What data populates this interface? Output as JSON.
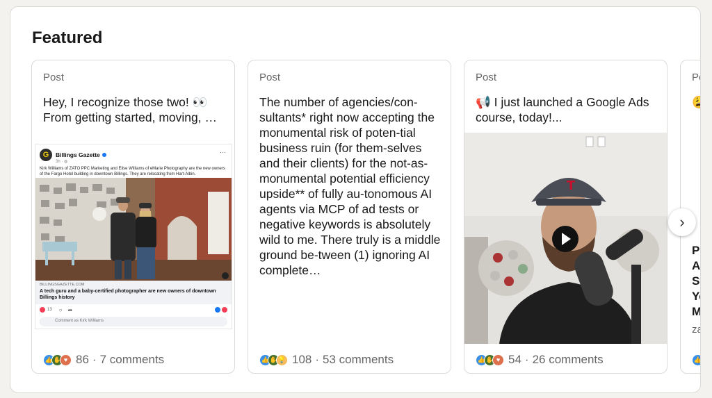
{
  "section": {
    "title": "Featured"
  },
  "cards": [
    {
      "type": "Post",
      "text": "Hey, I recognize those two! 👀 From getting started, moving, …",
      "reactions_count": "86",
      "comments": "7 comments",
      "embed": {
        "publisher": "Billings Gazette",
        "time": "3h · ◍",
        "caption": "Kirk Williams of ZATO PPC Marketing and Elise Williams of eMarie Photography are the new owners of the Fargo Hotel building in downtown Billings. They are relocating from Hart-Albin.",
        "domain": "BILLINGSGAZETTE.COM",
        "link_title": "A tech guru and a baby-certified photographer are new owners of downtown Billings history",
        "reaction_count": "13",
        "comment_placeholder": "Comment as Kirk Williams"
      }
    },
    {
      "type": "Post",
      "text": "The number of agencies/con-sultants* right now accepting the monumental risk of poten-tial business ruin (for them-selves and their clients) for the not-as-monumental potential efficiency upside** of fully au-tonomous AI agents via MCP of ad tests or negative keywords is absolutely wild to me. There truly is a middle ground be-tween (1) ignoring AI complete…",
      "reactions_count": "108",
      "comments": "53 comments"
    },
    {
      "type": "Post",
      "text": "📢 I just launched a Google Ads course, today!...",
      "reactions_count": "54",
      "comments": "26 comments"
    },
    {
      "type": "Po",
      "text": "😩 Pl",
      "lines": [
        "Pl",
        "At",
        "St",
        "Yo",
        "M"
      ],
      "author_snippet": "za"
    }
  ],
  "separator": "·",
  "icons": {
    "next": "chevron-right-icon",
    "play": "play-icon",
    "reactions": [
      "like-icon",
      "celebrate-icon",
      "love-icon",
      "insightful-icon"
    ]
  },
  "colors": {
    "like": "#378fe9",
    "celebrate": "#44712e",
    "love": "#df704d",
    "insight": "#f5bb5c"
  }
}
